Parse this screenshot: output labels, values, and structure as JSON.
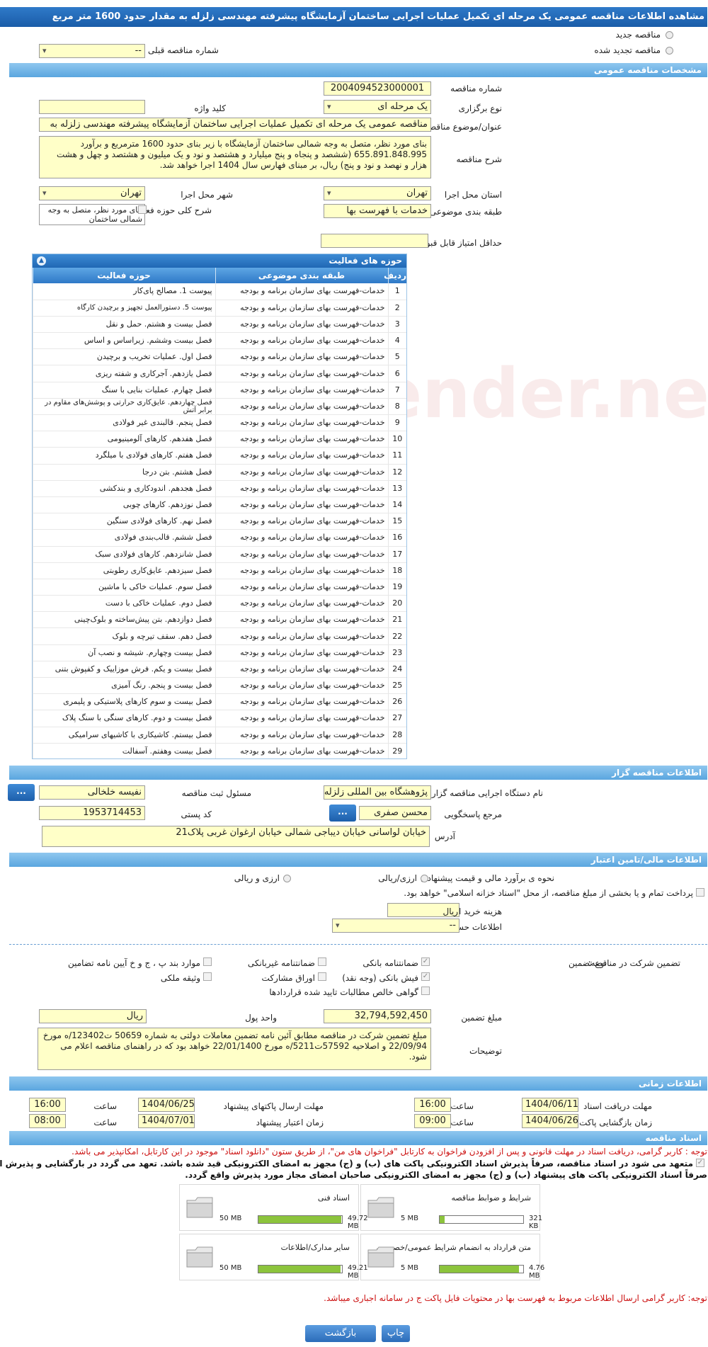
{
  "page_title": "مشاهده اطلاعات مناقصه عمومی یک مرحله ای تکمیل عملیات اجرایی ساختمان آزمایشگاه پیشرفته مهندسی زلزله به مقدار حدود 1600 متر مربع",
  "top": {
    "new_tender": "مناقصه جدید",
    "renewed_tender": "مناقصه تجدید شده",
    "prev_tender_label": "شماره مناقصه قبلی",
    "prev_tender_value": "--"
  },
  "general": {
    "section_title": "مشخصات مناقصه عمومی",
    "tender_number_label": "شماره مناقصه",
    "tender_number": "2004094523000001",
    "holding_type_label": "نوع برگزاری",
    "holding_type": "یک مرحله ای",
    "keyword_label": "کلید واژه",
    "subject_label": "عنوان/موضوع مناقصه",
    "subject": "مناقصه عمومی یک مرحله ای تکمیل عملیات اجرایی ساختمان آزمایشگاه پیشرفته مهندسی زلزله به",
    "description_label": "شرح مناقصه",
    "description": "بنای مورد نظر، متصل به وجه شمالی ساختمان آزمایشگاه با زیر بنای حدود 1600 مترمربع و برآورد 655.891.848.995 (ششصد و پنجاه و پنج میلیارد و هشتصد و نود و یک میلیون و هشتصد و چهل و هشت هزار و نهصد و نود و پنج) ریال، بر مبنای فهارس سال 1404 اجرا خواهد شد.",
    "province_label": "استان محل اجرا",
    "province": "تهران",
    "city_label": "شهر محل اجرا",
    "city": "تهران",
    "category_label": "طبقه بندی موضوعی",
    "category": "خدمات با فهرست بها",
    "activity_desc_label": "شرح کلی حوزه فعالیت",
    "activity_desc": "بنای مورد نظر، متصل به وجه شمالی ساختمان",
    "min_score_label": "حداقل امتیاز قابل قبول ارزیابی فنی/بازرگانی"
  },
  "activities": {
    "title": "حوزه های فعالیت",
    "headers": [
      "ردیف",
      "طبقه بندی موضوعی",
      "حوزه فعالیت"
    ],
    "rows": [
      [
        "1",
        "خدمات-فهرست بهای سازمان برنامه و بودجه",
        "پیوست 1. مصالح پای‌کار"
      ],
      [
        "2",
        "خدمات-فهرست بهای سازمان برنامه و بودجه",
        "پیوست 5. دستورالعمل تجهیز و برچیدن کارگاه"
      ],
      [
        "3",
        "خدمات-فهرست بهای سازمان برنامه و بودجه",
        "فصل بیست و هشتم. حمل و نقل"
      ],
      [
        "4",
        "خدمات-فهرست بهای سازمان برنامه و بودجه",
        "فصل بیست وششم. زیراساس و اساس"
      ],
      [
        "5",
        "خدمات-فهرست بهای سازمان برنامه و بودجه",
        "فصل اول. عملیات تخریب و برچیدن"
      ],
      [
        "6",
        "خدمات-فهرست بهای سازمان برنامه و بودجه",
        "فصل یازدهم. آجرکاری و شفته ریزی"
      ],
      [
        "7",
        "خدمات-فهرست بهای سازمان برنامه و بودجه",
        "فصل چهارم. عملیات بنایی با سنگ"
      ],
      [
        "8",
        "خدمات-فهرست بهای سازمان برنامه و بودجه",
        "فصل چهاردهم. عایق‌کاری حرارتی و پوشش‌های مقاوم در برابر آتش"
      ],
      [
        "9",
        "خدمات-فهرست بهای سازمان برنامه و بودجه",
        "فصل پنجم. قالبندی غیر فولادی"
      ],
      [
        "10",
        "خدمات-فهرست بهای سازمان برنامه و بودجه",
        "فصل هفدهم. کارهای آلومینیومی"
      ],
      [
        "11",
        "خدمات-فهرست بهای سازمان برنامه و بودجه",
        "فصل هفتم. کارهای فولادی با میلگرد"
      ],
      [
        "12",
        "خدمات-فهرست بهای سازمان برنامه و بودجه",
        "فصل هشتم. بتن درجا"
      ],
      [
        "13",
        "خدمات-فهرست بهای سازمان برنامه و بودجه",
        "فصل هجدهم. اندودکاری و بندکشی"
      ],
      [
        "14",
        "خدمات-فهرست بهای سازمان برنامه و بودجه",
        "فصل نوزدهم. کارهای چوبی"
      ],
      [
        "15",
        "خدمات-فهرست بهای سازمان برنامه و بودجه",
        "فصل نهم. کارهای فولادی سنگین"
      ],
      [
        "16",
        "خدمات-فهرست بهای سازمان برنامه و بودجه",
        "فصل ششم. قالب‌بندی فولادی"
      ],
      [
        "17",
        "خدمات-فهرست بهای سازمان برنامه و بودجه",
        "فصل شانزدهم. کارهای فولادی سبک"
      ],
      [
        "18",
        "خدمات-فهرست بهای سازمان برنامه و بودجه",
        "فصل سیزدهم. عایق‌کاری رطوبتی"
      ],
      [
        "19",
        "خدمات-فهرست بهای سازمان برنامه و بودجه",
        "فصل سوم. عملیات خاکی با ماشین"
      ],
      [
        "20",
        "خدمات-فهرست بهای سازمان برنامه و بودجه",
        "فصل دوم. عملیات خاکی با دست"
      ],
      [
        "21",
        "خدمات-فهرست بهای سازمان برنامه و بودجه",
        "فصل دوازدهم. بتن پیش‌ساخته و بلوک‌چینی"
      ],
      [
        "22",
        "خدمات-فهرست بهای سازمان برنامه و بودجه",
        "فصل دهم. سقف تیرچه و بلوک"
      ],
      [
        "23",
        "خدمات-فهرست بهای سازمان برنامه و بودجه",
        "فصل بیست وچهارم. شیشه و نصب آن"
      ],
      [
        "24",
        "خدمات-فهرست بهای سازمان برنامه و بودجه",
        "فصل بیست و یکم. فرش موزاییک و کفپوش بتنی"
      ],
      [
        "25",
        "خدمات-فهرست بهای سازمان برنامه و بودجه",
        "فصل بیست و پنجم. رنگ آمیزی"
      ],
      [
        "26",
        "خدمات-فهرست بهای سازمان برنامه و بودجه",
        "فصل بیست و سوم کارهای پلاستیکی و پلیمری"
      ],
      [
        "27",
        "خدمات-فهرست بهای سازمان برنامه و بودجه",
        "فصل بیست و دوم. کارهای سنگی با سنگ پلاک"
      ],
      [
        "28",
        "خدمات-فهرست بهای سازمان برنامه و بودجه",
        "فصل بیستم. کاشیکاری با کاشیهای سرامیکی"
      ],
      [
        "29",
        "خدمات-فهرست بهای سازمان برنامه و بودجه",
        "فصل بیست وهفتم. آسفالت"
      ]
    ]
  },
  "organizer": {
    "section_title": "اطلاعات مناقصه گزار",
    "org_name_label": "نام دستگاه اجرایی مناقصه گزار",
    "org_name": "پژوهشگاه بین المللی زلزله",
    "responsible_label": "مسئول ثبت مناقصه",
    "responsible": "نفیسه خلخالی",
    "reference_label": "مرجع پاسخگویی",
    "reference": "محسن صفری",
    "postal_label": "کد پستی",
    "postal": "1953714453",
    "address_label": "آدرس",
    "address": "خیابان لواسانی خیابان دیباجی شمالی خیابان ارغوان غربی پلاک21",
    "dots": "..."
  },
  "finance": {
    "section_title": "اطلاعات مالی/تامین اعتبار",
    "estimate_label": "نحوه ی برآورد مالی و قیمت پیشنهادی",
    "rial_option": "ارزی/ریالی",
    "rial_option2": "ارزی و ریالی",
    "treasury_text": "پرداخت تمام و یا بخشی از مبلغ مناقصه، از محل \"اسناد خزانه اسلامی\" خواهد بود.",
    "doc_fee_label": "هزینه خرید اسناد",
    "doc_fee_unit": "ریال",
    "account_label": "اطلاعات حساب جهت واریز هزینه خرید اسناد",
    "account_value": "--"
  },
  "guarantee": {
    "title_label": "تضمین شرکت در مناقصه:",
    "type_label": "نوع تضمین",
    "options": {
      "bank": "ضمانتنامه بانکی",
      "non_bank": "ضمانتنامه غیربانکی",
      "clauses": "موارد بند پ ، ج و خ آیین نامه تضامین",
      "cheque": "فیش بانکی (وجه نقد)",
      "bonds": "اوراق مشارکت",
      "property": "وثیقه ملکی",
      "receivables": "گواهی خالص مطالبات تایید شده قراردادها"
    },
    "amount_label": "مبلغ تضمین",
    "amount": "32,794,592,450",
    "currency_label": "واحد پول",
    "currency": "ریال",
    "notes_label": "توضیحات",
    "notes": "مبلغ تضمین شرکت در مناقصه مطابق آئین نامه تضمین معاملات دولتی به شماره 50659 ت123402/ه مورخ 22/09/94 و اصلاحیه 57592ت5211/ه مورخ 22/01/1400 خواهد بود که در راهنمای مناقصه اعلام می شود."
  },
  "timing": {
    "section_title": "اطلاعات زمانی",
    "receive_deadline_label": "مهلت دریافت اسناد",
    "receive_deadline_date": "1404/06/11",
    "receive_deadline_time": "16:00",
    "send_deadline_label": "مهلت ارسال پاکتهای پیشنهاد",
    "send_deadline_date": "1404/06/25",
    "send_deadline_time": "16:00",
    "opening_label": "زمان بازگشایی پاکت ها",
    "opening_date": "1404/06/26",
    "opening_time": "09:00",
    "validity_label": "زمان اعتبار پیشنهاد",
    "validity_date": "1404/07/01",
    "validity_time": "08:00",
    "time_label": "ساعت"
  },
  "documents": {
    "section_title": "اسناد مناقصه",
    "note1": "توجه : کاربر گرامی، دریافت اسناد در مهلت قانونی و پس از افزودن فراخوان به کارتابل \"فراخوان های من\"، از طریق ستون \"دانلود اسناد\" موجود در این کارتابل، امکانپذیر می باشد.",
    "note2": "متعهد می شود در اسناد مناقصه، صرفاً پذیرش اسناد الکترونیکی پاکت های (ب) و (ج) مجهز به امضای الکترونیکی قید شده باشد. تعهد می گردد در بارگشایی و پذیرش اسناد،",
    "note3": "صرفاً اسناد الکترونیکی پاکت های پیشنهاد (ب) و (ج) مجهز به امضای الکترونیکی صاحبان امضای مجاز مورد پذیرش واقع گردد.",
    "cards": [
      {
        "name": "شرایط و ضوابط مناقصه",
        "size": "321 KB",
        "max": "5 MB",
        "fill": 0.06
      },
      {
        "name": "اسناد فنی",
        "size": "49.72 MB",
        "max": "50 MB",
        "fill": 0.99
      },
      {
        "name": "متن قرارداد به انضمام شرایط عمومی/خصوصی",
        "size": "4.76 MB",
        "max": "5 MB",
        "fill": 0.95
      },
      {
        "name": "سایر مدارک/اطلاعات",
        "size": "49.21 MB",
        "max": "50 MB",
        "fill": 0.98
      }
    ],
    "note4": "توجه: کاربر گرامی ارسال اطلاعات مربوط به فهرست بها در محتویات فایل پاکت ج در سامانه اجباری میباشد."
  },
  "buttons": {
    "print": "چاپ",
    "back": "بازگشت"
  },
  "watermark": "AriaTender.neT"
}
